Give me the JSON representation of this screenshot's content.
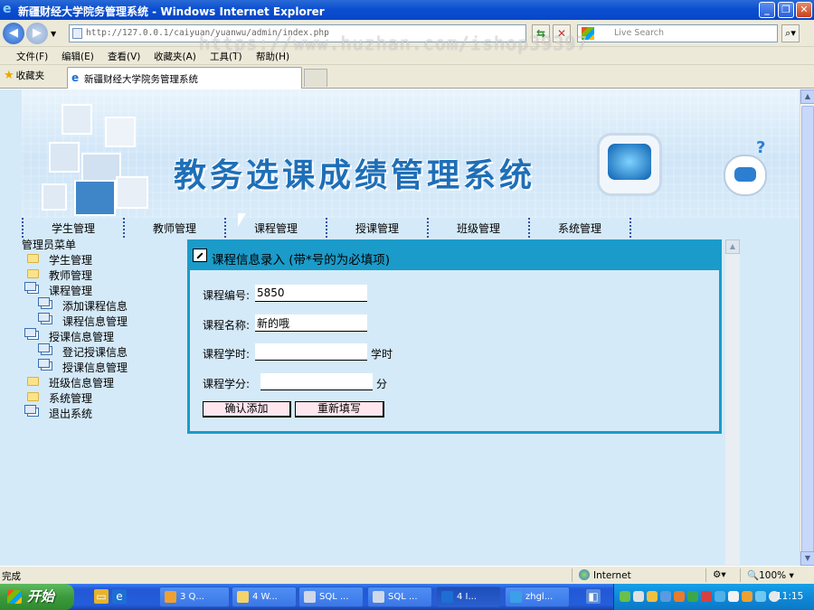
{
  "window": {
    "title": "新疆财经大学院务管理系统 - Windows Internet Explorer"
  },
  "address_bar": {
    "url": "http://127.0.0.1/caiyuan/yuanwu/admin/index.php",
    "search_placeholder": "Live Search"
  },
  "watermark": "https://www.huzhan.com/ishop39397",
  "menubar": [
    "文件(F)",
    "编辑(E)",
    "查看(V)",
    "收藏夹(A)",
    "工具(T)",
    "帮助(H)"
  ],
  "favorites_label": "收藏夹",
  "tab": {
    "title": "新疆财经大学院务管理系统"
  },
  "banner": {
    "title": "教务选课成绩管理系统"
  },
  "top_nav": [
    "学生管理",
    "教师管理",
    "课程管理",
    "授课管理",
    "班级管理",
    "系统管理"
  ],
  "sidebar": {
    "title": "管理员菜单",
    "items": [
      {
        "label": "学生管理",
        "icon": "folder-icon",
        "level": 0
      },
      {
        "label": "教师管理",
        "icon": "folder-icon",
        "level": 0
      },
      {
        "label": "课程管理",
        "icon": "window-icon",
        "level": 0
      },
      {
        "label": "添加课程信息",
        "icon": "window-icon",
        "level": 1
      },
      {
        "label": "课程信息管理",
        "icon": "window-icon",
        "level": 1
      },
      {
        "label": "授课信息管理",
        "icon": "window-icon",
        "level": 0
      },
      {
        "label": "登记授课信息",
        "icon": "window-icon",
        "level": 1
      },
      {
        "label": "授课信息管理",
        "icon": "window-icon",
        "level": 1
      },
      {
        "label": "班级信息管理",
        "icon": "folder-icon",
        "level": 0
      },
      {
        "label": "系统管理",
        "icon": "folder-icon",
        "level": 0
      },
      {
        "label": "退出系统",
        "icon": "window-icon",
        "level": 0
      }
    ]
  },
  "form": {
    "title": "课程信息录入 (带*号的为必填项)",
    "fields": {
      "course_id": {
        "label": "课程编号:",
        "value": "5850"
      },
      "course_name": {
        "label": "课程名称:",
        "value": "新的哦"
      },
      "course_hours": {
        "label": "课程学时:",
        "value": "",
        "unit": "学时"
      },
      "course_credit": {
        "label": "课程学分:",
        "value": "",
        "unit": "分"
      }
    },
    "submit_label": "确认添加",
    "reset_label": "重新填写"
  },
  "statusbar": {
    "left": "完成",
    "zone": "Internet",
    "zoom": "100%"
  },
  "taskbar": {
    "start": "开始",
    "tasks": [
      "3 Q...",
      "4 W...",
      "SQL ...",
      "SQL ...",
      "4 I...",
      "zhgl..."
    ],
    "clock": "11:15"
  },
  "colors": {
    "panel_border": "#1b9bc9",
    "banner_title": "#1e6fb8",
    "button_bg": "#ffe6ef"
  }
}
